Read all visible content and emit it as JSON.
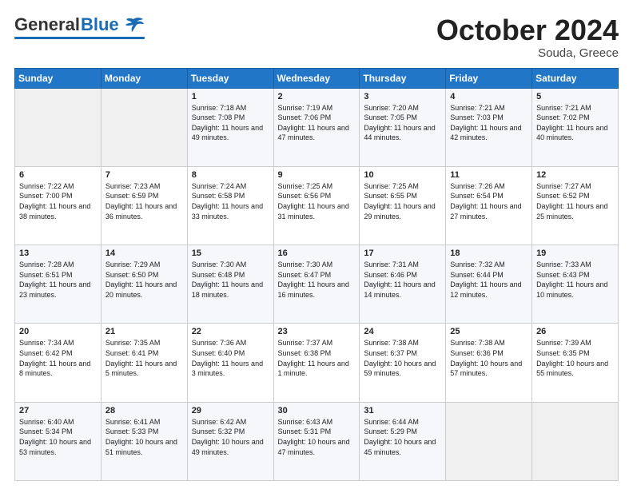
{
  "logo": {
    "general": "General",
    "blue": "Blue"
  },
  "header": {
    "month": "October 2024",
    "location": "Souda, Greece"
  },
  "days_of_week": [
    "Sunday",
    "Monday",
    "Tuesday",
    "Wednesday",
    "Thursday",
    "Friday",
    "Saturday"
  ],
  "weeks": [
    [
      {
        "day": "",
        "sunrise": "",
        "sunset": "",
        "daylight": ""
      },
      {
        "day": "",
        "sunrise": "",
        "sunset": "",
        "daylight": ""
      },
      {
        "day": "1",
        "sunrise": "Sunrise: 7:18 AM",
        "sunset": "Sunset: 7:08 PM",
        "daylight": "Daylight: 11 hours and 49 minutes."
      },
      {
        "day": "2",
        "sunrise": "Sunrise: 7:19 AM",
        "sunset": "Sunset: 7:06 PM",
        "daylight": "Daylight: 11 hours and 47 minutes."
      },
      {
        "day": "3",
        "sunrise": "Sunrise: 7:20 AM",
        "sunset": "Sunset: 7:05 PM",
        "daylight": "Daylight: 11 hours and 44 minutes."
      },
      {
        "day": "4",
        "sunrise": "Sunrise: 7:21 AM",
        "sunset": "Sunset: 7:03 PM",
        "daylight": "Daylight: 11 hours and 42 minutes."
      },
      {
        "day": "5",
        "sunrise": "Sunrise: 7:21 AM",
        "sunset": "Sunset: 7:02 PM",
        "daylight": "Daylight: 11 hours and 40 minutes."
      }
    ],
    [
      {
        "day": "6",
        "sunrise": "Sunrise: 7:22 AM",
        "sunset": "Sunset: 7:00 PM",
        "daylight": "Daylight: 11 hours and 38 minutes."
      },
      {
        "day": "7",
        "sunrise": "Sunrise: 7:23 AM",
        "sunset": "Sunset: 6:59 PM",
        "daylight": "Daylight: 11 hours and 36 minutes."
      },
      {
        "day": "8",
        "sunrise": "Sunrise: 7:24 AM",
        "sunset": "Sunset: 6:58 PM",
        "daylight": "Daylight: 11 hours and 33 minutes."
      },
      {
        "day": "9",
        "sunrise": "Sunrise: 7:25 AM",
        "sunset": "Sunset: 6:56 PM",
        "daylight": "Daylight: 11 hours and 31 minutes."
      },
      {
        "day": "10",
        "sunrise": "Sunrise: 7:25 AM",
        "sunset": "Sunset: 6:55 PM",
        "daylight": "Daylight: 11 hours and 29 minutes."
      },
      {
        "day": "11",
        "sunrise": "Sunrise: 7:26 AM",
        "sunset": "Sunset: 6:54 PM",
        "daylight": "Daylight: 11 hours and 27 minutes."
      },
      {
        "day": "12",
        "sunrise": "Sunrise: 7:27 AM",
        "sunset": "Sunset: 6:52 PM",
        "daylight": "Daylight: 11 hours and 25 minutes."
      }
    ],
    [
      {
        "day": "13",
        "sunrise": "Sunrise: 7:28 AM",
        "sunset": "Sunset: 6:51 PM",
        "daylight": "Daylight: 11 hours and 23 minutes."
      },
      {
        "day": "14",
        "sunrise": "Sunrise: 7:29 AM",
        "sunset": "Sunset: 6:50 PM",
        "daylight": "Daylight: 11 hours and 20 minutes."
      },
      {
        "day": "15",
        "sunrise": "Sunrise: 7:30 AM",
        "sunset": "Sunset: 6:48 PM",
        "daylight": "Daylight: 11 hours and 18 minutes."
      },
      {
        "day": "16",
        "sunrise": "Sunrise: 7:30 AM",
        "sunset": "Sunset: 6:47 PM",
        "daylight": "Daylight: 11 hours and 16 minutes."
      },
      {
        "day": "17",
        "sunrise": "Sunrise: 7:31 AM",
        "sunset": "Sunset: 6:46 PM",
        "daylight": "Daylight: 11 hours and 14 minutes."
      },
      {
        "day": "18",
        "sunrise": "Sunrise: 7:32 AM",
        "sunset": "Sunset: 6:44 PM",
        "daylight": "Daylight: 11 hours and 12 minutes."
      },
      {
        "day": "19",
        "sunrise": "Sunrise: 7:33 AM",
        "sunset": "Sunset: 6:43 PM",
        "daylight": "Daylight: 11 hours and 10 minutes."
      }
    ],
    [
      {
        "day": "20",
        "sunrise": "Sunrise: 7:34 AM",
        "sunset": "Sunset: 6:42 PM",
        "daylight": "Daylight: 11 hours and 8 minutes."
      },
      {
        "day": "21",
        "sunrise": "Sunrise: 7:35 AM",
        "sunset": "Sunset: 6:41 PM",
        "daylight": "Daylight: 11 hours and 5 minutes."
      },
      {
        "day": "22",
        "sunrise": "Sunrise: 7:36 AM",
        "sunset": "Sunset: 6:40 PM",
        "daylight": "Daylight: 11 hours and 3 minutes."
      },
      {
        "day": "23",
        "sunrise": "Sunrise: 7:37 AM",
        "sunset": "Sunset: 6:38 PM",
        "daylight": "Daylight: 11 hours and 1 minute."
      },
      {
        "day": "24",
        "sunrise": "Sunrise: 7:38 AM",
        "sunset": "Sunset: 6:37 PM",
        "daylight": "Daylight: 10 hours and 59 minutes."
      },
      {
        "day": "25",
        "sunrise": "Sunrise: 7:38 AM",
        "sunset": "Sunset: 6:36 PM",
        "daylight": "Daylight: 10 hours and 57 minutes."
      },
      {
        "day": "26",
        "sunrise": "Sunrise: 7:39 AM",
        "sunset": "Sunset: 6:35 PM",
        "daylight": "Daylight: 10 hours and 55 minutes."
      }
    ],
    [
      {
        "day": "27",
        "sunrise": "Sunrise: 6:40 AM",
        "sunset": "Sunset: 5:34 PM",
        "daylight": "Daylight: 10 hours and 53 minutes."
      },
      {
        "day": "28",
        "sunrise": "Sunrise: 6:41 AM",
        "sunset": "Sunset: 5:33 PM",
        "daylight": "Daylight: 10 hours and 51 minutes."
      },
      {
        "day": "29",
        "sunrise": "Sunrise: 6:42 AM",
        "sunset": "Sunset: 5:32 PM",
        "daylight": "Daylight: 10 hours and 49 minutes."
      },
      {
        "day": "30",
        "sunrise": "Sunrise: 6:43 AM",
        "sunset": "Sunset: 5:31 PM",
        "daylight": "Daylight: 10 hours and 47 minutes."
      },
      {
        "day": "31",
        "sunrise": "Sunrise: 6:44 AM",
        "sunset": "Sunset: 5:29 PM",
        "daylight": "Daylight: 10 hours and 45 minutes."
      },
      {
        "day": "",
        "sunrise": "",
        "sunset": "",
        "daylight": ""
      },
      {
        "day": "",
        "sunrise": "",
        "sunset": "",
        "daylight": ""
      }
    ]
  ]
}
